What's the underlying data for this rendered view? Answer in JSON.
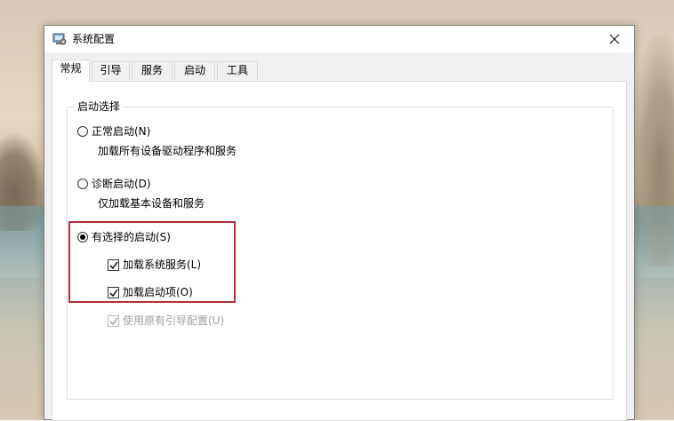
{
  "window": {
    "title": "系统配置"
  },
  "tabs": [
    {
      "label": "常规",
      "active": true
    },
    {
      "label": "引导",
      "active": false
    },
    {
      "label": "服务",
      "active": false
    },
    {
      "label": "启动",
      "active": false
    },
    {
      "label": "工具",
      "active": false
    }
  ],
  "startup_selection": {
    "group_title": "启动选择",
    "normal": {
      "label": "正常启动(N)",
      "description": "加载所有设备驱动程序和服务",
      "checked": false
    },
    "diagnostic": {
      "label": "诊断启动(D)",
      "description": "仅加载基本设备和服务",
      "checked": false
    },
    "selective": {
      "label": "有选择的启动(S)",
      "checked": true,
      "options": {
        "load_system_services": {
          "label": "加载系统服务(L)",
          "checked": true
        },
        "load_startup_items": {
          "label": "加载启动项(O)",
          "checked": true
        },
        "use_original_boot_config": {
          "label": "使用原有引导配置(U)",
          "checked": true,
          "disabled": true
        }
      }
    }
  },
  "colors": {
    "highlight_box": "#b0313a"
  }
}
